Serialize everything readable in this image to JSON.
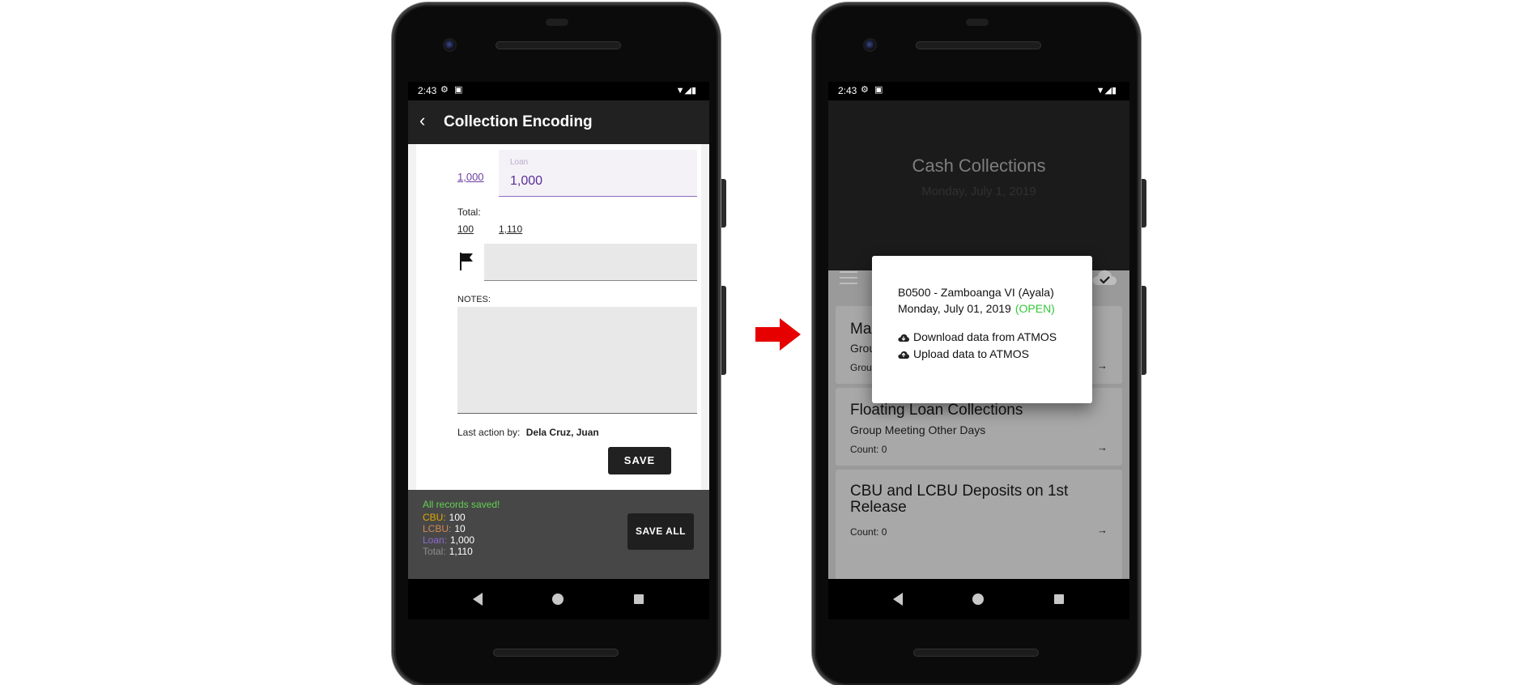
{
  "left_phone": {
    "status_time": "2:43",
    "app_title": "Collection Encoding",
    "loan_value_link": "1,000",
    "loan_label": "Loan",
    "loan_input_value": "1,000",
    "total_label": "Total:",
    "total_value_a": "100",
    "total_value_b": "1,110",
    "notes_label": "NOTES:",
    "last_action_label": "Last action by:",
    "last_action_user": "Dela Cruz, Juan",
    "save_button": "SAVE",
    "summary": {
      "saved_msg": "All records saved!",
      "rows": [
        {
          "key": "CBU:",
          "value": "100",
          "color": "#e0a800"
        },
        {
          "key": "LCBU:",
          "value": "10",
          "color": "#d08a55"
        },
        {
          "key": "Loan:",
          "value": "1,000",
          "color": "#8e6bd0"
        },
        {
          "key": "Total:",
          "value": "1,110",
          "color": "#8d8d8d"
        }
      ],
      "save_all_button": "SAVE ALL"
    }
  },
  "right_phone": {
    "status_time": "2:43",
    "header_title": "Cash Collections",
    "header_date": "Monday, July 1, 2019",
    "cards": [
      {
        "title": "Ma",
        "subtitle": "Grou",
        "count": "Grou"
      },
      {
        "title": "Floating Loan Collections",
        "subtitle": "Group Meeting Other Days",
        "count": "Count:  0"
      },
      {
        "title": "CBU and LCBU Deposits on 1st Release",
        "count": "Count:  0"
      }
    ],
    "dialog": {
      "branch": "B0500  -  Zamboanga VI (Ayala)",
      "date": "Monday,  July 01, 2019",
      "status": "(OPEN)",
      "download_option": "Download data from ATMOS",
      "upload_option": "Upload data to ATMOS"
    }
  },
  "colors": {
    "accent_purple": "#5a2d96",
    "open_green": "#35c738",
    "saved_green": "#62d152",
    "arrow_red": "#e60000"
  }
}
